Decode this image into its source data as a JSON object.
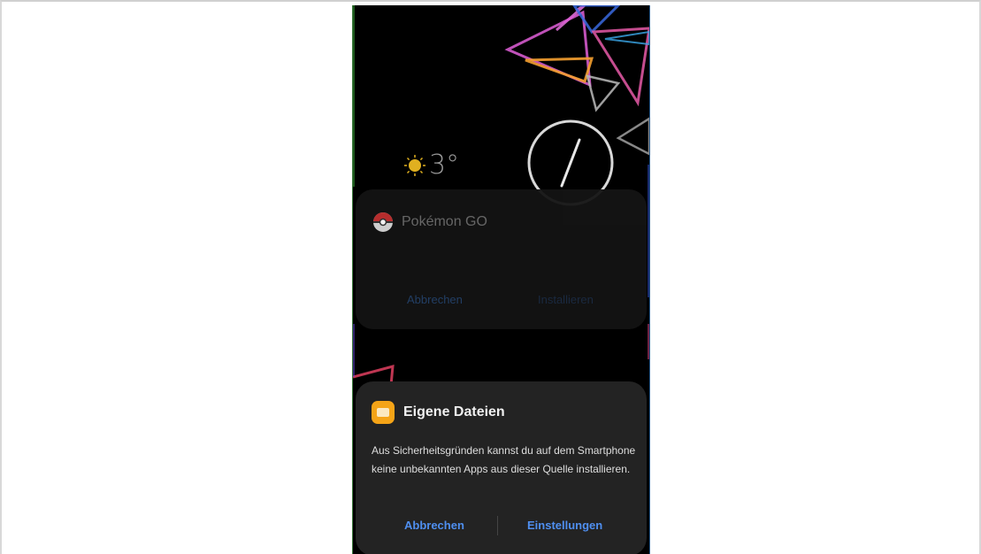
{
  "lockscreen": {
    "weather": {
      "icon": "sun-icon",
      "temperature": "3°"
    },
    "clock_icon": "analog-clock-icon"
  },
  "background_dialog": {
    "app_icon": "pokeball-icon",
    "app_name": "Pokémon GO",
    "cancel_label": "Abbrechen",
    "install_label": "Installieren"
  },
  "dialog": {
    "app_icon": "my-files-folder-icon",
    "title": "Eigene Dateien",
    "message": "Aus Sicherheitsgründen kannst du auf dem Smartphone keine unbekannten Apps aus dieser Quelle installieren.",
    "cancel_label": "Abbrechen",
    "settings_label": "Einstellungen",
    "accent_color": "#4f8ff0",
    "icon_color": "#f5a417"
  }
}
